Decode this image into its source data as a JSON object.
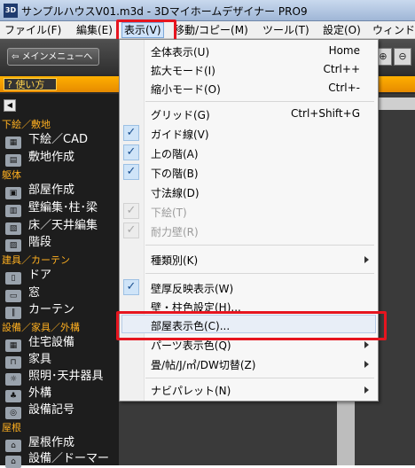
{
  "window": {
    "icon_text": "3D",
    "title": "サンプルハウスV01.m3d - 3Dマイホームデザイナー PRO9"
  },
  "menubar": {
    "items": [
      "ファイル(F)",
      "編集(E)",
      "表示(V)",
      "移動/コピー(M)",
      "ツール(T)",
      "設定(O)",
      "ウィンドウ"
    ],
    "active_index": 2
  },
  "toolbar": {
    "main_menu_label": "メインメニューへ",
    "zoom_in_icon": "magnifier-plus-icon",
    "zoom_out_icon": "magnifier-minus-icon"
  },
  "help": {
    "label": "? 使い方"
  },
  "sidebar": {
    "sections": [
      {
        "title": "下絵／敷地",
        "items": [
          {
            "label": "下絵／CAD",
            "icon": "image-icon"
          },
          {
            "label": "敷地作成",
            "icon": "site-icon"
          }
        ]
      },
      {
        "title": "躯体",
        "items": [
          {
            "label": "部屋作成",
            "icon": "room-icon"
          },
          {
            "label": "壁編集･柱･梁",
            "icon": "wall-icon"
          },
          {
            "label": "床／天井編集",
            "icon": "floor-icon"
          },
          {
            "label": "階段",
            "icon": "stairs-icon"
          }
        ]
      },
      {
        "title": "建具／カーテン",
        "items": [
          {
            "label": "ドア",
            "icon": "door-icon"
          },
          {
            "label": "窓",
            "icon": "window-icon"
          },
          {
            "label": "カーテン",
            "icon": "curtain-icon"
          }
        ]
      },
      {
        "title": "設備／家具／外構",
        "items": [
          {
            "label": "住宅設備",
            "icon": "kitchen-icon"
          },
          {
            "label": "家具",
            "icon": "furniture-icon"
          },
          {
            "label": "照明･天井器具",
            "icon": "light-icon"
          },
          {
            "label": "外構",
            "icon": "tree-icon"
          },
          {
            "label": "設備記号",
            "icon": "symbol-icon"
          }
        ]
      },
      {
        "title": "屋根",
        "items": [
          {
            "label": "屋根作成",
            "icon": "roof-icon"
          },
          {
            "label": "設備／ドーマー",
            "icon": "dormer-icon"
          }
        ]
      }
    ]
  },
  "dropdown": {
    "items": [
      {
        "label": "全体表示(U)",
        "shortcut": "Home"
      },
      {
        "label": "拡大モード(I)",
        "shortcut": "Ctrl++"
      },
      {
        "label": "縮小モード(O)",
        "shortcut": "Ctrl+-"
      },
      {
        "label": "グリッド(G)",
        "shortcut": "Ctrl+Shift+G"
      },
      {
        "label": "ガイド線(V)",
        "checked": true
      },
      {
        "label": "上の階(A)",
        "checked": true
      },
      {
        "label": "下の階(B)",
        "checked": true
      },
      {
        "label": "寸法線(D)"
      },
      {
        "label": "下絵(T)",
        "checked": true,
        "disabled": true
      },
      {
        "label": "耐力壁(R)",
        "checked": true,
        "disabled": true
      },
      {
        "label": "種類別(K)",
        "submenu": true
      },
      {
        "label": "壁厚反映表示(W)",
        "checked": true
      },
      {
        "label": "壁・柱色設定(H)..."
      },
      {
        "label": "部屋表示色(C)..."
      },
      {
        "label": "パーツ表示色(Q)",
        "submenu": true
      },
      {
        "label": "畳/帖/J/㎡/DW切替(Z)",
        "submenu": true
      },
      {
        "label": "ナビパレット(N)",
        "submenu": true
      }
    ]
  },
  "colors": {
    "highlight": "#e6151f",
    "accent": "#ffb020"
  }
}
